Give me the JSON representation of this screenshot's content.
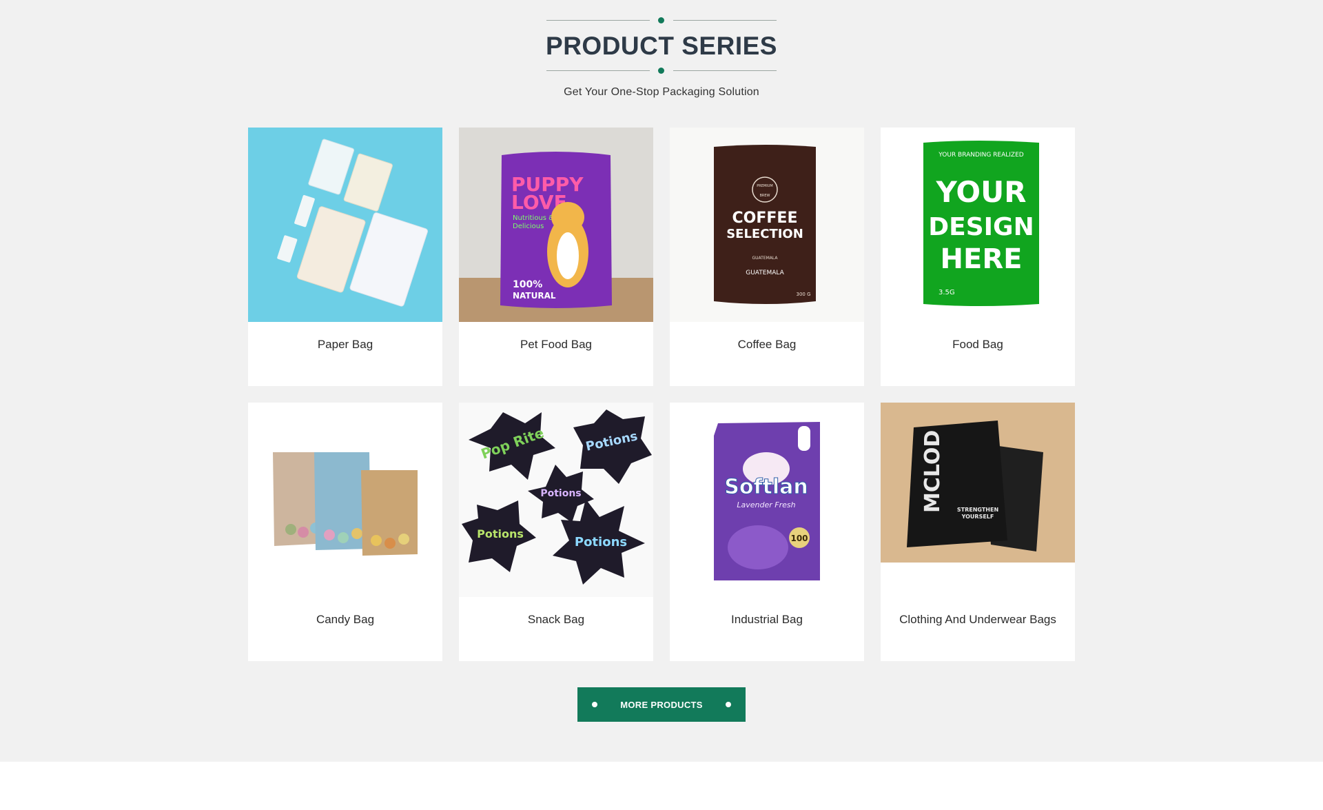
{
  "header": {
    "title": "PRODUCT SERIES",
    "subtitle": "Get Your One-Stop Packaging Solution"
  },
  "products": [
    {
      "label": "Paper Bag",
      "image": "paper-bag-image"
    },
    {
      "label": "Pet Food Bag",
      "image": "pet-food-bag-image",
      "print": [
        "PUPPY",
        "LOVE",
        "Nutritious &",
        "Delicious",
        "100%",
        "NATURAL"
      ]
    },
    {
      "label": "Coffee Bag",
      "image": "coffee-bag-image",
      "print": [
        "PREMIUM",
        "BREW",
        "COFFEE",
        "SELECTION",
        "GUATEMALA",
        "GUATEMALA",
        "300 G"
      ]
    },
    {
      "label": "Food Bag",
      "image": "food-bag-image",
      "print": [
        "YOUR BRANDING REALIZED",
        "YOUR",
        "DESIGN",
        "HERE",
        "3.5G"
      ]
    },
    {
      "label": "Candy Bag",
      "image": "candy-bag-image"
    },
    {
      "label": "Snack Bag",
      "image": "snack-bag-image",
      "print": [
        "Pop Rite",
        "Potions"
      ]
    },
    {
      "label": "Industrial Bag",
      "image": "industrial-bag-image",
      "print": [
        "Softlan",
        "Lavender Fresh",
        "100"
      ]
    },
    {
      "label": "Clothing And Underwear Bags",
      "image": "clothing-bag-image",
      "print": [
        "MCLOD",
        "STRENGTHEN",
        "YOURSELF"
      ]
    }
  ],
  "more_button": {
    "label": "MORE PRODUCTS"
  },
  "colors": {
    "accent": "#127a5a",
    "background": "#f1f1f1",
    "card": "#ffffff",
    "title": "#2e3a47"
  }
}
